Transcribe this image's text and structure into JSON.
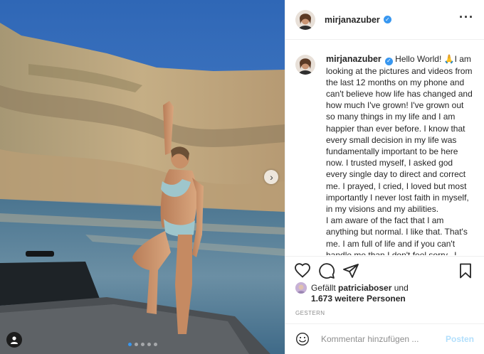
{
  "header": {
    "username": "mirjanazuber",
    "verified": true,
    "more_icon": "more-dots-icon"
  },
  "caption": {
    "username": "mirjanazuber",
    "paragraphs": [
      "Hello World! 🙏I am looking at the pictures and videos from the last 12 months on my phone and can't believe how life has changed and how much I've grown! I've grown out so many things in my life and I am happier than ever before. I know that every small decision in my life was fundamentally important to be here now. I trusted myself, I asked god every single day to direct and correct me. I prayed, I cried, I loved but most importantly I never lost faith in myself, in my visions and my abilities.",
      "I am aware of the fact that I am anything but normal. I like that. That's me. I am full of life and if you can't handle me than I don't feel sorry.. I"
    ]
  },
  "actions": {
    "icons": [
      "heart-icon",
      "comment-icon",
      "share-icon",
      "bookmark-icon"
    ]
  },
  "likes": {
    "prefix": "Gefällt",
    "user": "patriciaboser",
    "connector": "und",
    "others": "1.673 weitere Personen"
  },
  "timestamp": "GESTERN",
  "comment_box": {
    "placeholder": "Kommentar hinzufügen ...",
    "post_label": "Posten"
  },
  "carousel": {
    "slides": 5,
    "active_index": 0
  },
  "colors": {
    "accent": "#3897f0",
    "post_button_disabled": "#b2dffc",
    "border": "#efefef",
    "muted_text": "#8e8e8e"
  }
}
